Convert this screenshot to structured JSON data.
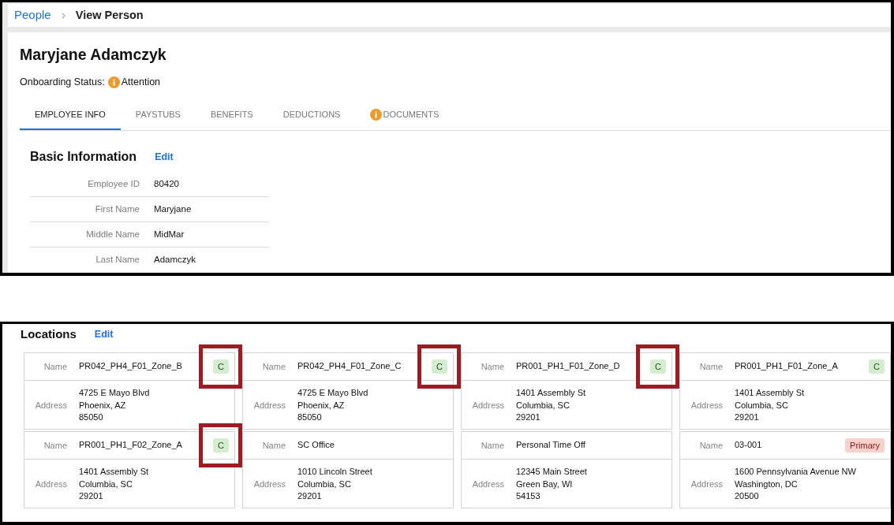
{
  "breadcrumb": [
    {
      "label": "People",
      "kind": "link"
    },
    {
      "label": "View Person",
      "kind": "current"
    }
  ],
  "person": {
    "name": "Maryjane Adamczyk",
    "onboarding_status": {
      "label": "Onboarding Status:",
      "value": "Attention",
      "alert": true
    }
  },
  "tabs": [
    {
      "label": "EMPLOYEE INFO",
      "selected": true,
      "alert": false
    },
    {
      "label": "PAYSTUBS",
      "selected": false,
      "alert": false
    },
    {
      "label": "BENEFITS",
      "selected": false,
      "alert": false
    },
    {
      "label": "DEDUCTIONS",
      "selected": false,
      "alert": false
    },
    {
      "label": "DOCUMENTS",
      "selected": false,
      "alert": true
    }
  ],
  "basic_information": {
    "title": "Basic Information",
    "edit": "Edit",
    "fields": [
      {
        "label": "Employee ID",
        "value": "80420"
      },
      {
        "label": "First Name",
        "value": "Maryjane"
      },
      {
        "label": "Middle Name",
        "value": "MidMar"
      },
      {
        "label": "Last Name",
        "value": "Adamczyk"
      }
    ]
  },
  "locations": {
    "title": "Locations",
    "edit": "Edit",
    "cards": [
      {
        "name_label": "Name",
        "name": "PR042_PH4_F01_Zone_B",
        "badge": {
          "text": "C",
          "kind": "code"
        },
        "address_label": "Address",
        "address": [
          "4725 E Mayo Blvd",
          "Phoenix, AZ",
          "85050"
        ],
        "highlighted": true
      },
      {
        "name_label": "Name",
        "name": "PR042_PH4_F01_Zone_C",
        "badge": {
          "text": "C",
          "kind": "code"
        },
        "address_label": "Address",
        "address": [
          "4725 E Mayo Blvd",
          "Phoenix, AZ",
          "85050"
        ],
        "highlighted": true
      },
      {
        "name_label": "Name",
        "name": "PR001_PH1_F01_Zone_D",
        "badge": {
          "text": "C",
          "kind": "code"
        },
        "address_label": "Address",
        "address": [
          "1401 Assembly St",
          "Columbia, SC",
          "29201"
        ],
        "highlighted": true
      },
      {
        "name_label": "Name",
        "name": "PR001_PH1_F01_Zone_A",
        "badge": {
          "text": "C",
          "kind": "code"
        },
        "address_label": "Address",
        "address": [
          "1401 Assembly St",
          "Columbia, SC",
          "29201"
        ],
        "highlighted": false
      },
      {
        "name_label": "Name",
        "name": "PR001_PH1_F02_Zone_A",
        "badge": {
          "text": "C",
          "kind": "code"
        },
        "address_label": "Address",
        "address": [
          "1401 Assembly St",
          "Columbia, SC",
          "29201"
        ],
        "highlighted": true
      },
      {
        "name_label": "Name",
        "name": "SC Office",
        "address_label": "Address",
        "address": [
          "1010 Lincoln Street",
          "Columbia, SC",
          "29201"
        ],
        "highlighted": false
      },
      {
        "name_label": "Name",
        "name": "Personal Time Off",
        "address_label": "Address",
        "address": [
          "12345 Main Street",
          "Green Bay, WI",
          "54153"
        ],
        "highlighted": false
      },
      {
        "name_label": "Name",
        "name": "03-001",
        "badge": {
          "text": "Primary",
          "kind": "primary"
        },
        "address_label": "Address",
        "address": [
          "1600 Pennsylvania Avenue NW",
          "Washington, DC",
          "20500"
        ],
        "highlighted": false
      }
    ]
  }
}
